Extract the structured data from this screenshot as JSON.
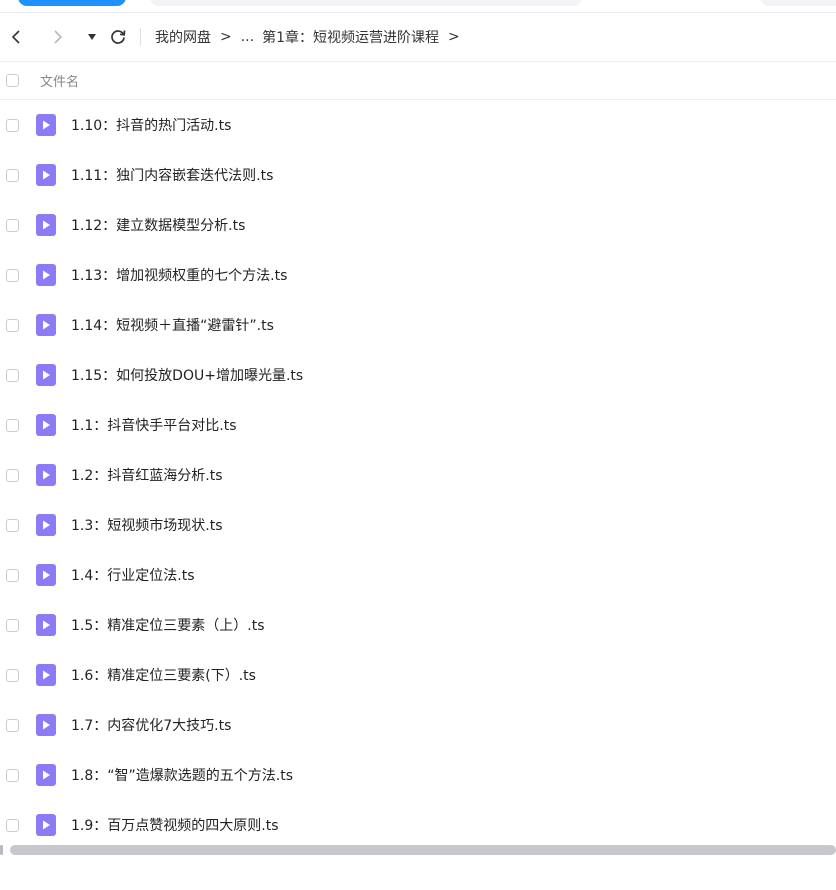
{
  "nav": {
    "breadcrumb": [
      "我的网盘",
      "..."
    ],
    "separator": ">",
    "current": "第1章：短视频运营进阶课程"
  },
  "header": {
    "filename_label": "文件名"
  },
  "files": [
    "1.10：抖音的热门活动.ts",
    "1.11：独门内容嵌套迭代法则.ts",
    "1.12：建立数据模型分析.ts",
    "1.13：增加视频权重的七个方法.ts",
    "1.14：短视频＋直播“避雷针”.ts",
    "1.15：如何投放DOU+增加曝光量.ts",
    "1.1：抖音快手平台对比.ts",
    "1.2：抖音红蓝海分析.ts",
    "1.3：短视频市场现状.ts",
    "1.4：行业定位法.ts",
    "1.5：精准定位三要素（上）.ts",
    "1.6：精准定位三要素(下）.ts",
    "1.7：内容优化7大技巧.ts",
    "1.8：“智”造爆款选题的五个方法.ts",
    "1.9：百万点赞视频的四大原则.ts"
  ],
  "icons": {
    "file": "video-file-icon",
    "back": "chevron-left-icon",
    "forward": "chevron-right-icon",
    "dropdown": "caret-down-icon",
    "refresh": "refresh-icon"
  },
  "colors": {
    "file_icon": "#8b7cf6",
    "accent": "#1e90ff"
  }
}
